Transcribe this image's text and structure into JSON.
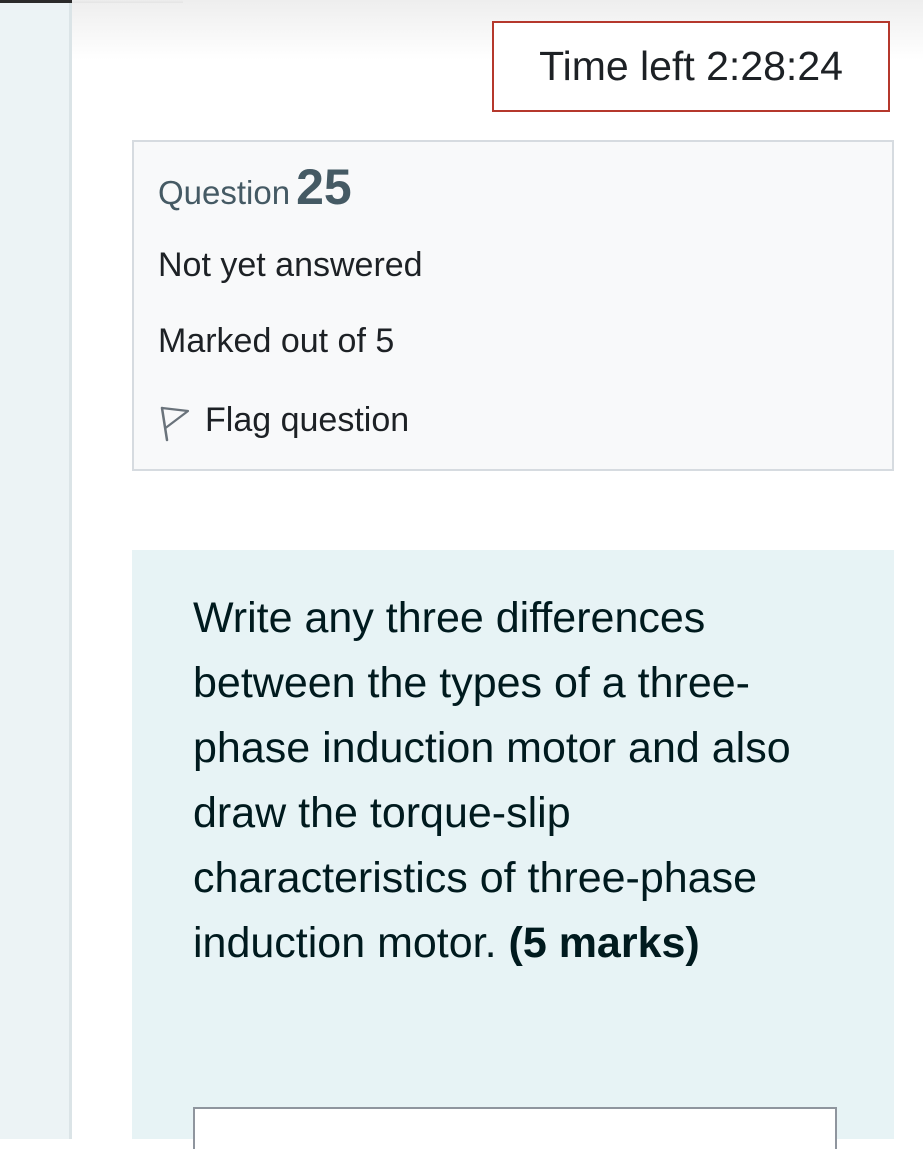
{
  "timer": {
    "label": "Time left 2:28:24",
    "border_color": "#b5382c"
  },
  "question_info": {
    "label": "Question",
    "number": "25",
    "state": "Not yet answered",
    "grade": "Marked out of 5",
    "flag_label": "Flag question",
    "flag_icon": "flag-outline-icon"
  },
  "question": {
    "text": "Write any three differences between the types of a three-phase induction motor and also draw the torque-slip characteristics of three-phase induction motor. ",
    "marks": "(5 marks)",
    "background_color": "#e7f3f5"
  }
}
